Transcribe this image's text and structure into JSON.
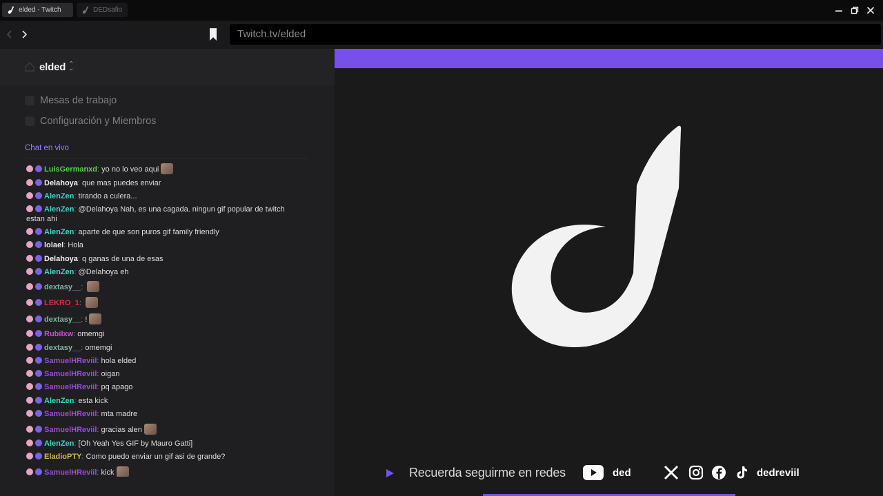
{
  "titlebar": {
    "tabs": [
      {
        "label": "elded - Twitch",
        "active": true
      },
      {
        "label": "DEDsafio",
        "active": false
      }
    ]
  },
  "navbar": {
    "url": "Twitch.tv/elded"
  },
  "sidebar": {
    "workspace": "elded",
    "nav": [
      {
        "label": "Mesas de trabajo"
      },
      {
        "label": "Configuración y Miembros"
      }
    ],
    "chat_label": "Chat en vivo"
  },
  "chat": [
    {
      "user": "LuisGermanxd",
      "color": "#57d04a",
      "text": "yo no lo veo aqui",
      "emote": true
    },
    {
      "user": "Delahoya",
      "color": "#f2f2f2",
      "text": "que mas puedes enviar"
    },
    {
      "user": "AlenZen",
      "color": "#3fd6c9",
      "text": "tirando a culera..."
    },
    {
      "user": "AlenZen",
      "color": "#3fd6c9",
      "text": "@Delahoya Nah, es una cagada. ningun gif popular de twitch estan ahi"
    },
    {
      "user": "AlenZen",
      "color": "#3fd6c9",
      "text": "aparte de que son puros gif family friendly"
    },
    {
      "user": "lolael",
      "color": "#e8e8e8",
      "text": "Hola"
    },
    {
      "user": "Delahoya",
      "color": "#f2f2f2",
      "text": "q ganas de una de esas"
    },
    {
      "user": "AlenZen",
      "color": "#3fd6c9",
      "text": "@Delahoya eh"
    },
    {
      "user": "dextasy__",
      "color": "#7fb5a8",
      "text": "",
      "emote": true
    },
    {
      "user": "LEKRO_1",
      "color": "#e0303a",
      "text": "",
      "emote": true
    },
    {
      "user": "dextasy__",
      "color": "#7fb5a8",
      "text": "!",
      "emote": true
    },
    {
      "user": "Rubilxw",
      "color": "#d14bd6",
      "text": "omemgi"
    },
    {
      "user": "dextasy__",
      "color": "#7fb5a8",
      "text": "omemgi"
    },
    {
      "user": "SamuelHReviil",
      "color": "#9a4dd4",
      "text": "hola elded"
    },
    {
      "user": "SamuelHReviil",
      "color": "#9a4dd4",
      "text": "oigan"
    },
    {
      "user": "SamuelHReviil",
      "color": "#9a4dd4",
      "text": "pq apago"
    },
    {
      "user": "AlenZen",
      "color": "#3fd6c9",
      "text": "esta kick"
    },
    {
      "user": "SamuelHReviil",
      "color": "#9a4dd4",
      "text": "mta madre"
    },
    {
      "user": "SamuelHReviil",
      "color": "#9a4dd4",
      "text": "gracias alen",
      "emote": true
    },
    {
      "user": "AlenZen",
      "color": "#3fd6c9",
      "text": "[Oh Yeah Yes GIF by Mauro Gatti]"
    },
    {
      "user": "EladioPTY",
      "color": "#d7b94a",
      "text": "Como puedo enviar un gif asi de grande?"
    },
    {
      "user": "SamuelHReviil",
      "color": "#9a4dd4",
      "text": "kick",
      "emote": true
    }
  ],
  "stream": {
    "promo_text": "Recuerda seguirme en redes",
    "handle_youtube": "ded",
    "handle_social": "dedreviil",
    "accent": "#7650e8",
    "progress": 0.46
  }
}
